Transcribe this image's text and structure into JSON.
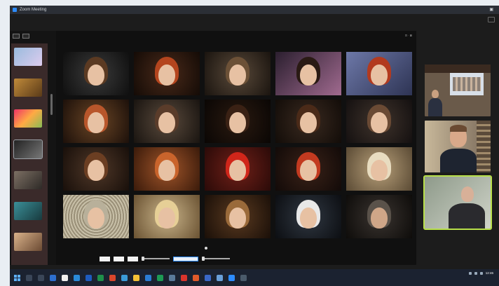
{
  "window": {
    "title": "Zoom Meeting"
  },
  "taskbar": {
    "clock": {
      "time": "12:46",
      "date": ""
    }
  },
  "icons": {
    "app": "zoom-icon",
    "taskbar": [
      "windows-start-icon",
      "search-icon",
      "task-view-icon",
      "app-icon",
      "app-icon",
      "app-icon",
      "app-icon",
      "app-icon",
      "app-icon",
      "app-icon",
      "app-icon",
      "app-icon",
      "app-icon",
      "app-icon",
      "app-icon",
      "app-icon",
      "app-icon",
      "app-icon",
      "zoom-icon",
      "app-icon"
    ]
  },
  "colors": {
    "zoom_blue": "#2d8cff",
    "active_speaker": "#b8e04a",
    "taskbar": "#1b2230"
  },
  "viewer_bottom": {
    "control_1": "",
    "control_2": "",
    "control_3": "",
    "control_4": ""
  }
}
